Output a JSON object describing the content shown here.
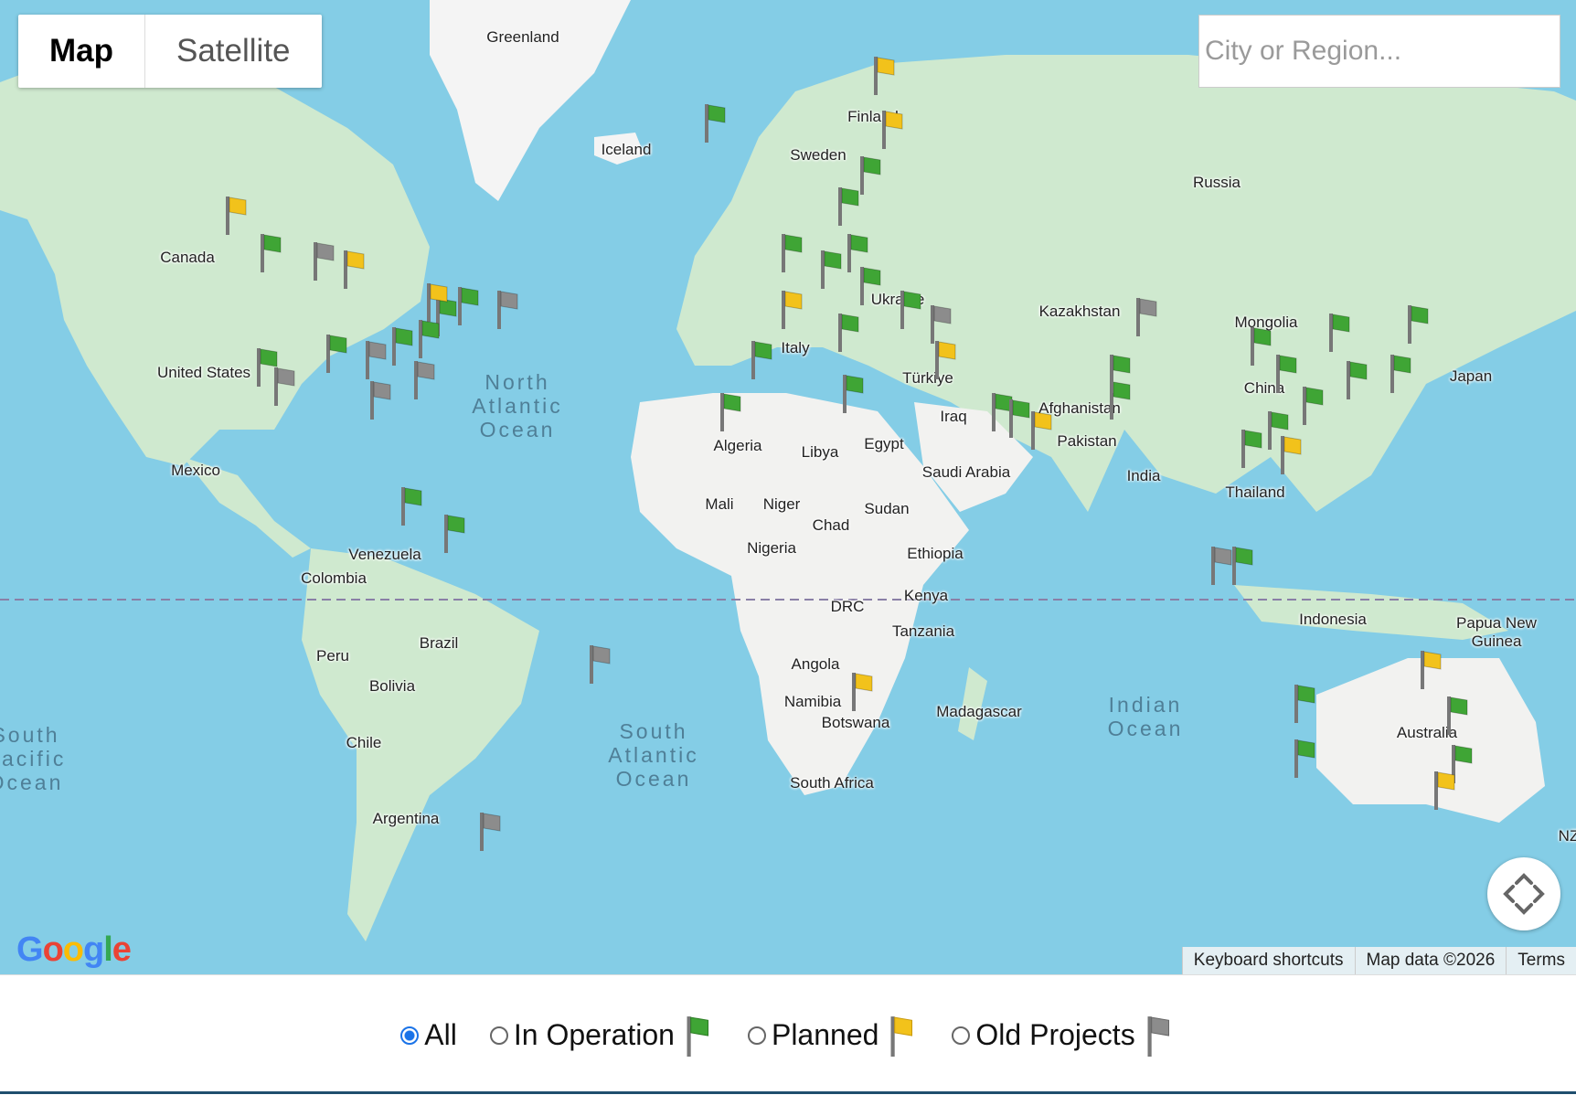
{
  "map_type": {
    "map_label": "Map",
    "satellite_label": "Satellite",
    "selected": "Map"
  },
  "search": {
    "placeholder": "City or Region...",
    "value": ""
  },
  "map_labels": {
    "greenland": "Greenland",
    "iceland": "Iceland",
    "finland": "Finland",
    "sweden": "Sweden",
    "russia": "Russia",
    "canada": "Canada",
    "united_states": "United States",
    "mexico": "Mexico",
    "venezuela": "Venezuela",
    "colombia": "Colombia",
    "brazil": "Brazil",
    "peru": "Peru",
    "bolivia": "Bolivia",
    "chile": "Chile",
    "argentina": "Argentina",
    "ukraine": "Ukraine",
    "italy": "Italy",
    "algeria": "Algeria",
    "libya": "Libya",
    "egypt": "Egypt",
    "mali": "Mali",
    "niger": "Niger",
    "chad": "Chad",
    "sudan": "Sudan",
    "nigeria": "Nigeria",
    "ethiopia": "Ethiopia",
    "kenya": "Kenya",
    "drc": "DRC",
    "tanzania": "Tanzania",
    "angola": "Angola",
    "namibia": "Namibia",
    "botswana": "Botswana",
    "south_africa": "South Africa",
    "madagascar": "Madagascar",
    "kazakhstan": "Kazakhstan",
    "mongolia": "Mongolia",
    "china": "China",
    "japan": "Japan",
    "turkiye": "Türkiye",
    "iraq": "Iraq",
    "afghanistan": "Afghanistan",
    "pakistan": "Pakistan",
    "saudi_arabia": "Saudi Arabia",
    "india": "India",
    "thailand": "Thailand",
    "indonesia": "Indonesia",
    "papua_new_guinea": "Papua New Guinea",
    "australia": "Australia",
    "new_zealand": "NZ"
  },
  "ocean_labels": {
    "north_atlantic": "North\nAtlantic\nOcean",
    "south_atlantic": "South\nAtlantic\nOcean",
    "indian": "Indian\nOcean",
    "south_pacific": "South\nPacific\nOcean"
  },
  "colors": {
    "in_operation": "#3fa535",
    "planned": "#f2c21b",
    "old_projects": "#8c8c8c",
    "water": "#84cde6",
    "land": "#cfe9cf",
    "radio_selected": "#1a73e8"
  },
  "attribution": {
    "google_logo": "Google",
    "keyboard_shortcuts": "Keyboard shortcuts",
    "map_data": "Map data ©2026",
    "terms": "Terms"
  },
  "legend": {
    "options": [
      {
        "label": "All",
        "selected": true
      },
      {
        "label": "In Operation",
        "icon": "green-flag-icon"
      },
      {
        "label": "Planned",
        "icon": "yellow-flag-icon"
      },
      {
        "label": "Old Projects",
        "icon": "gray-flag-icon"
      }
    ]
  },
  "markers": [
    {
      "status": "in_operation",
      "lat": 64.5,
      "lon": -18.5
    },
    {
      "status": "in_operation",
      "lat": 52,
      "lon": -120
    },
    {
      "status": "planned",
      "lat": 56,
      "lon": -128
    },
    {
      "status": "old_projects",
      "lat": 51,
      "lon": -108
    },
    {
      "status": "planned",
      "lat": 50,
      "lon": -101
    },
    {
      "status": "in_operation",
      "lat": 45.5,
      "lon": -75
    },
    {
      "status": "in_operation",
      "lat": 44,
      "lon": -80
    },
    {
      "status": "planned",
      "lat": 46,
      "lon": -82
    },
    {
      "status": "old_projects",
      "lat": 45,
      "lon": -66
    },
    {
      "status": "in_operation",
      "lat": 40,
      "lon": -90
    },
    {
      "status": "old_projects",
      "lat": 38,
      "lon": -96
    },
    {
      "status": "in_operation",
      "lat": 41,
      "lon": -84
    },
    {
      "status": "old_projects",
      "lat": 35,
      "lon": -85
    },
    {
      "status": "old_projects",
      "lat": 32,
      "lon": -95
    },
    {
      "status": "in_operation",
      "lat": 37,
      "lon": -121
    },
    {
      "status": "old_projects",
      "lat": 34,
      "lon": -117
    },
    {
      "status": "in_operation",
      "lat": 39,
      "lon": -105
    },
    {
      "status": "in_operation",
      "lat": 14,
      "lon": -88
    },
    {
      "status": "in_operation",
      "lat": 9,
      "lon": -78
    },
    {
      "status": "old_projects",
      "lat": -15,
      "lon": -45
    },
    {
      "status": "old_projects",
      "lat": -42,
      "lon": -70
    },
    {
      "status": "in_operation",
      "lat": 52,
      "lon": -1
    },
    {
      "status": "planned",
      "lat": 45,
      "lon": -1
    },
    {
      "status": "in_operation",
      "lat": 38,
      "lon": -8
    },
    {
      "status": "in_operation",
      "lat": 50,
      "lon": 8
    },
    {
      "status": "in_operation",
      "lat": 52,
      "lon": 14
    },
    {
      "status": "in_operation",
      "lat": 48,
      "lon": 17
    },
    {
      "status": "in_operation",
      "lat": 57,
      "lon": 12
    },
    {
      "status": "in_operation",
      "lat": 60,
      "lon": 17
    },
    {
      "status": "planned",
      "lat": 64,
      "lon": 22
    },
    {
      "status": "planned",
      "lat": 68,
      "lon": 20
    },
    {
      "status": "in_operation",
      "lat": 42,
      "lon": 12
    },
    {
      "status": "in_operation",
      "lat": 45,
      "lon": 26
    },
    {
      "status": "old_projects",
      "lat": 43,
      "lon": 33
    },
    {
      "status": "in_operation",
      "lat": 33,
      "lon": 13
    },
    {
      "status": "planned",
      "lat": 38,
      "lon": 34
    },
    {
      "status": "in_operation",
      "lat": 30,
      "lon": 47
    },
    {
      "status": "in_operation",
      "lat": 29,
      "lon": 51
    },
    {
      "status": "planned",
      "lat": 27,
      "lon": 56
    },
    {
      "status": "in_operation",
      "lat": 32,
      "lon": 74
    },
    {
      "status": "in_operation",
      "lat": 36,
      "lon": 74
    },
    {
      "status": "old_projects",
      "lat": 44,
      "lon": 80
    },
    {
      "status": "in_operation",
      "lat": 40,
      "lon": 106
    },
    {
      "status": "in_operation",
      "lat": 36,
      "lon": 112
    },
    {
      "status": "in_operation",
      "lat": 31,
      "lon": 118
    },
    {
      "status": "in_operation",
      "lat": 27,
      "lon": 110
    },
    {
      "status": "in_operation",
      "lat": 24,
      "lon": 104
    },
    {
      "status": "planned",
      "lat": 23,
      "lon": 113
    },
    {
      "status": "in_operation",
      "lat": 42,
      "lon": 124
    },
    {
      "status": "in_operation",
      "lat": 35,
      "lon": 128
    },
    {
      "status": "in_operation",
      "lat": 36,
      "lon": 138
    },
    {
      "status": "in_operation",
      "lat": 43,
      "lon": 142
    },
    {
      "status": "old_projects",
      "lat": 3,
      "lon": 97
    },
    {
      "status": "in_operation",
      "lat": 3,
      "lon": 102
    },
    {
      "status": "in_operation",
      "lat": -22,
      "lon": 116
    },
    {
      "status": "in_operation",
      "lat": -31,
      "lon": 116
    },
    {
      "status": "planned",
      "lat": -16,
      "lon": 145
    },
    {
      "status": "in_operation",
      "lat": -24,
      "lon": 151
    },
    {
      "status": "in_operation",
      "lat": -32,
      "lon": 152
    },
    {
      "status": "planned",
      "lat": -36,
      "lon": 148
    },
    {
      "status": "planned",
      "lat": -20,
      "lon": 15
    },
    {
      "status": "in_operation",
      "lat": 30,
      "lon": -15
    }
  ]
}
